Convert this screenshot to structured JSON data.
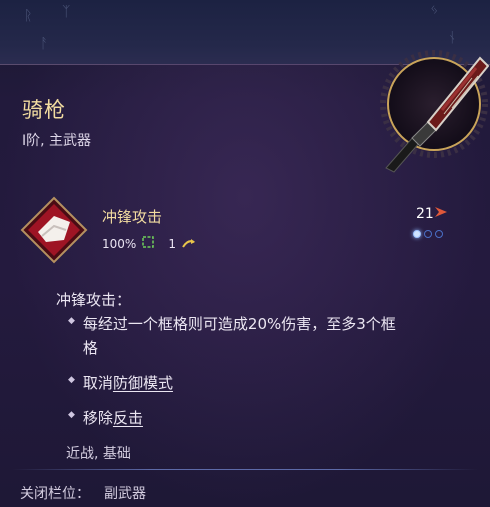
{
  "item": {
    "name": "骑枪",
    "subtitle": "I阶, 主武器"
  },
  "skill": {
    "name": "冲锋攻击",
    "accuracy": "100%",
    "range": "1",
    "cost": "21",
    "charges_total": 3,
    "charges_filled": 1
  },
  "description": {
    "title": "冲锋攻击：",
    "bullets": [
      {
        "text": "每经过一个框格则可造成20%伤害，至多3个框",
        "cont": "格"
      },
      {
        "prefix": "取消",
        "link": "防御模式"
      },
      {
        "prefix": "移除",
        "link": "反击"
      }
    ],
    "tags": "近战, 基础"
  },
  "footer": {
    "label": "关闭栏位：",
    "value": "副武器"
  },
  "colors": {
    "title_gold": "#f2dca0",
    "charge_blue": "#4a6fc6"
  },
  "icons": [
    "weapon-emblem",
    "charge-attack-icon",
    "accuracy-icon",
    "range-arrow-icon",
    "cost-icon",
    "charge-dot"
  ]
}
